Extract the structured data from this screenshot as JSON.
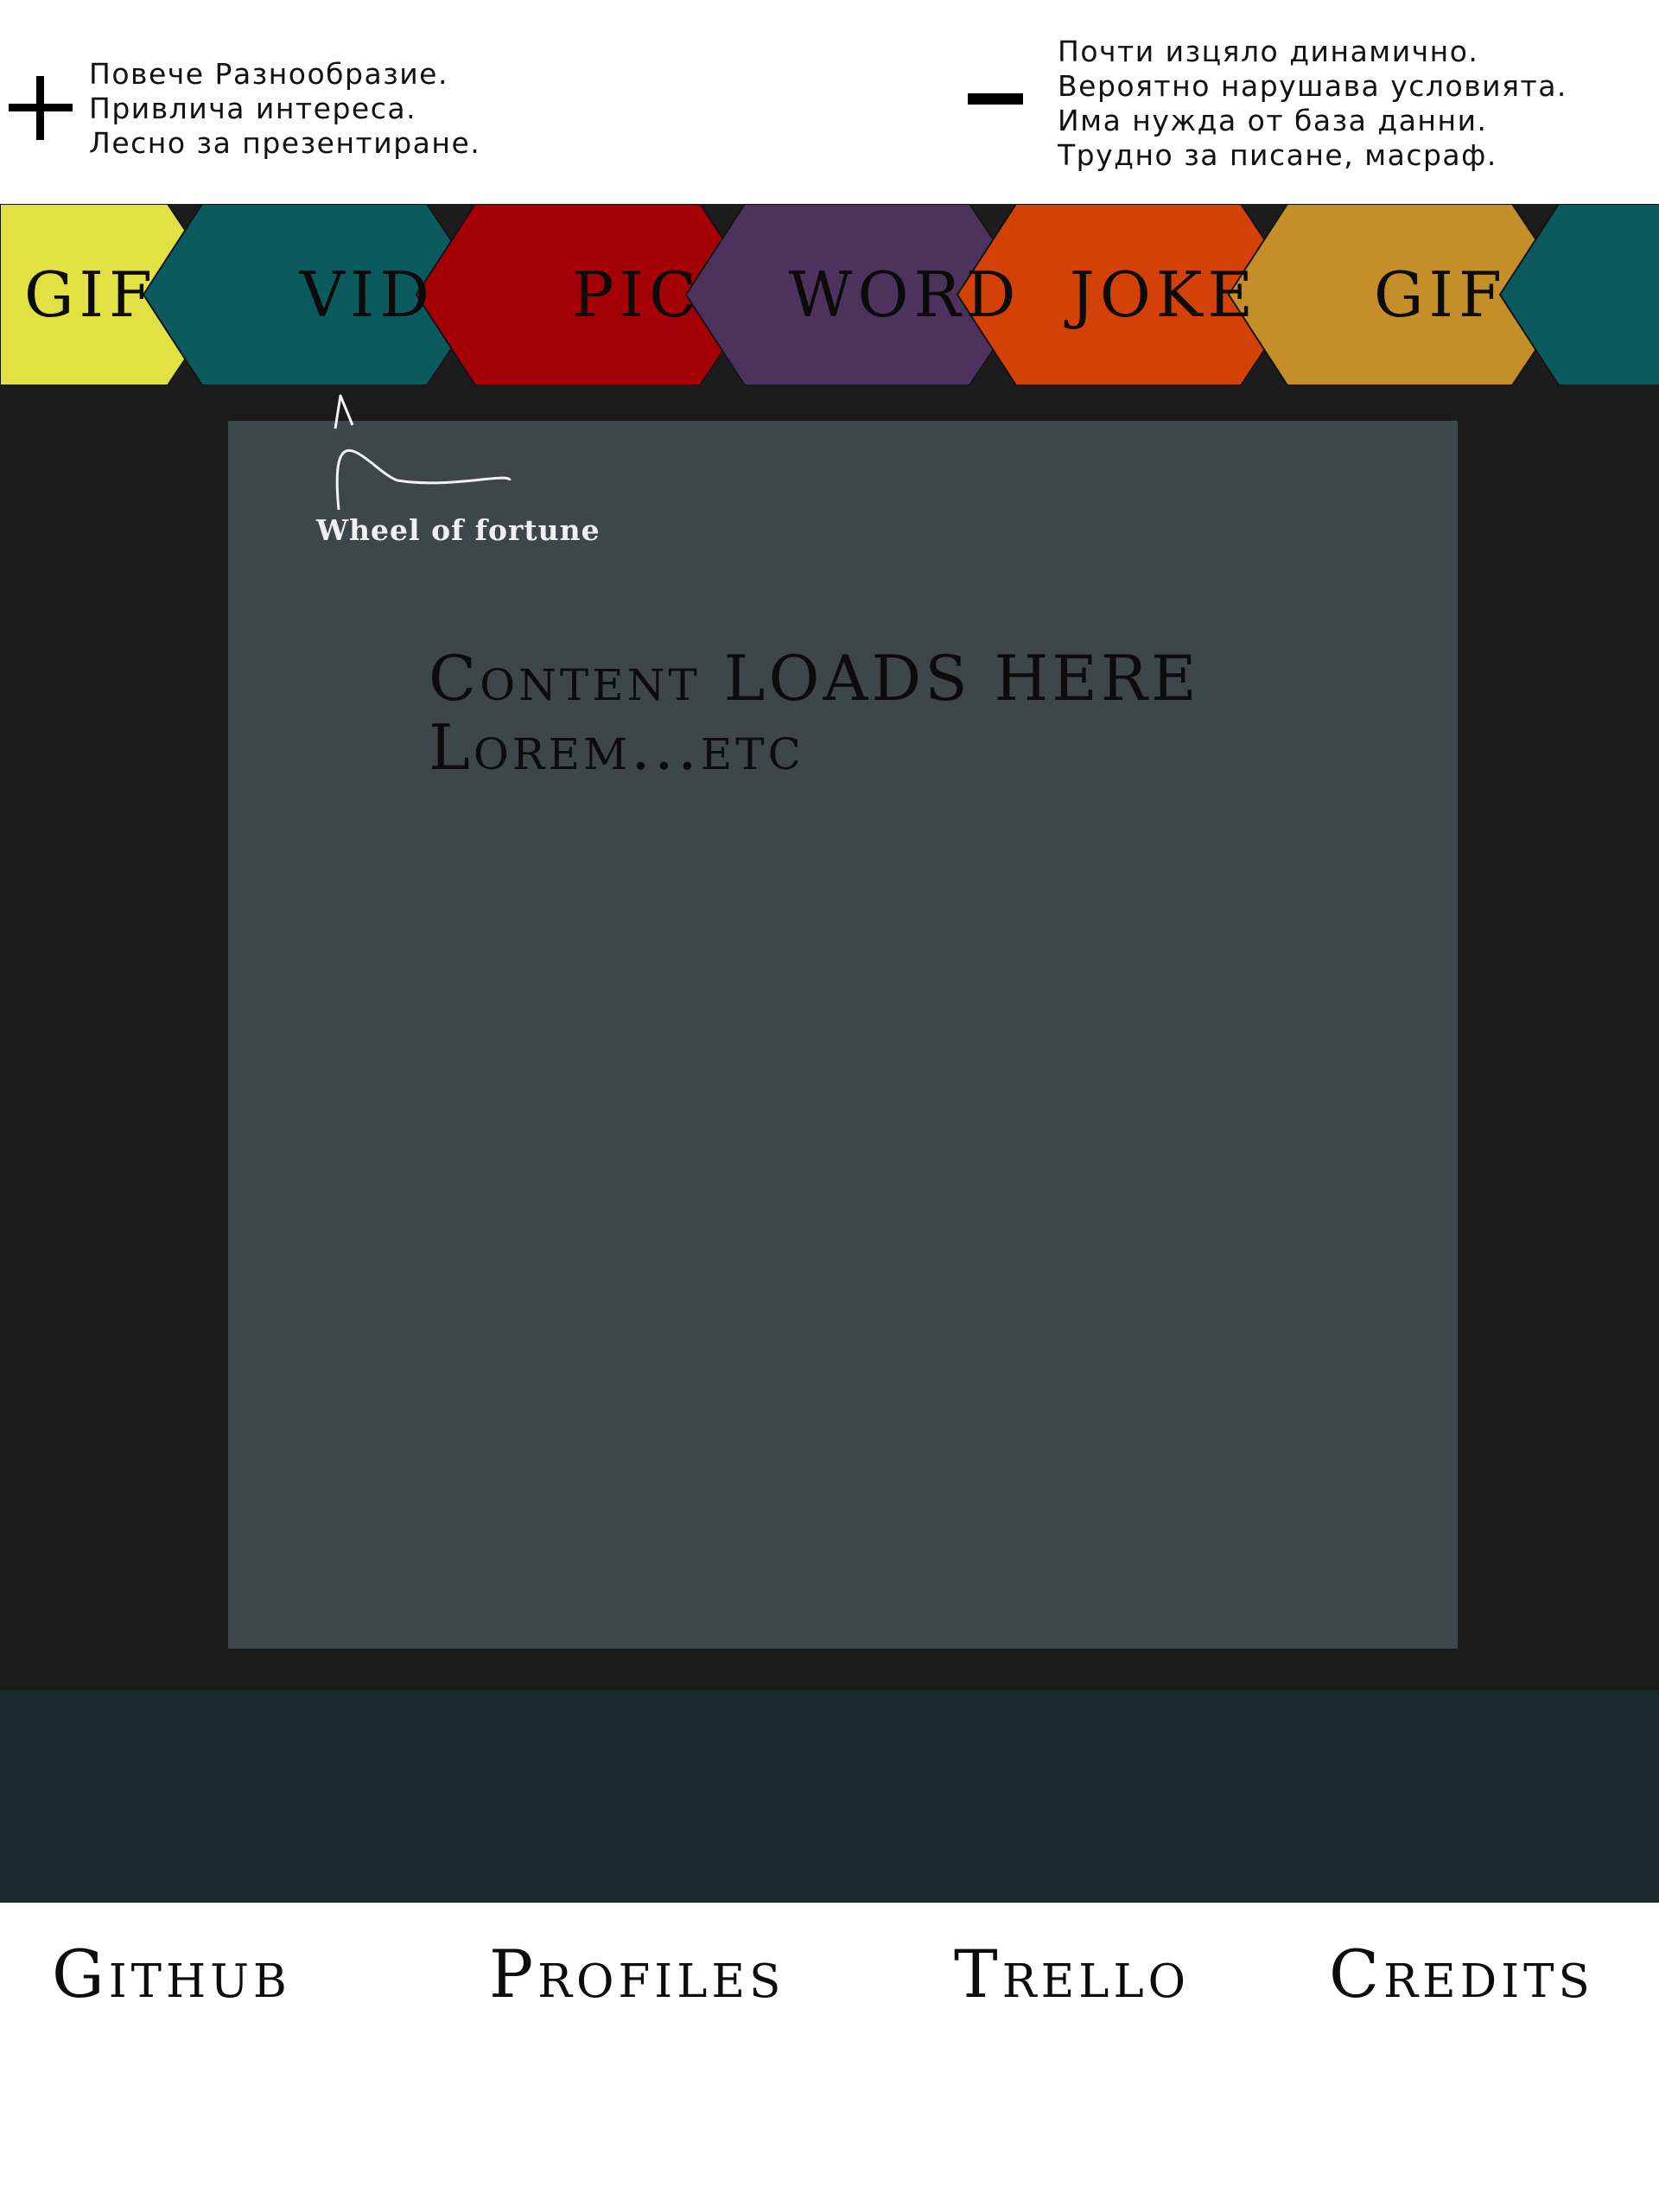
{
  "notes": {
    "plus_icon": "plus-icon",
    "minus_icon": "minus-icon",
    "pros": [
      "Повече Разнообразие.",
      "Привлича интереса.",
      "Лесно за презентиране."
    ],
    "cons": [
      "Почти изцяло динамично.",
      "Вероятно нарушава условията.",
      "Има нужда от база данни.",
      "Трудно за писане, масраф."
    ]
  },
  "wheel": {
    "items": [
      {
        "label": "GIF",
        "color": "#e2e143"
      },
      {
        "label": "VID",
        "color": "#0b5a5e"
      },
      {
        "label": "PIC",
        "color": "#a50005"
      },
      {
        "label": "WORD",
        "color": "#4d325e"
      },
      {
        "label": "JOKE",
        "color": "#d44106"
      },
      {
        "label": "GIF",
        "color": "#c48e28"
      },
      {
        "label": "",
        "color": "#0b5a5e"
      }
    ],
    "annotation": "Wheel of fortune"
  },
  "main": {
    "content_line1": "Content LOADS HERE",
    "content_line2": "Lorem...etc"
  },
  "footer": {
    "links": [
      "Github",
      "Profiles",
      "Trello",
      "Credits"
    ]
  }
}
